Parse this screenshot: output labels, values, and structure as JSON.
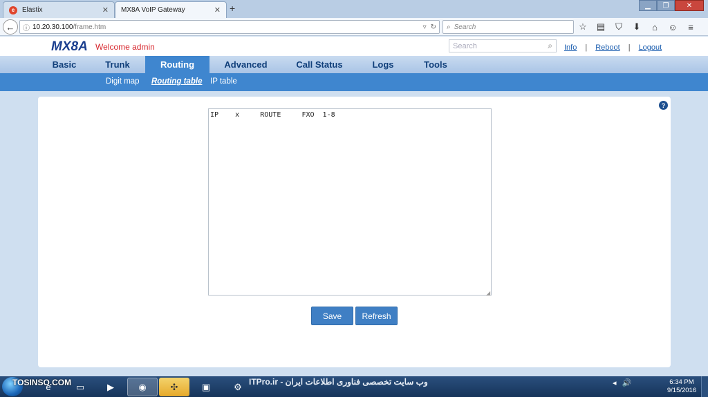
{
  "browser": {
    "tabs": [
      {
        "title": "Elastix",
        "active": false
      },
      {
        "title": "MX8A VoIP Gateway",
        "active": true
      }
    ],
    "new_tab": "+",
    "url_host": "10.20.30.100",
    "url_path": "/frame.htm",
    "search_placeholder": "Search"
  },
  "app": {
    "logo": "MX8A",
    "welcome": "Welcome admin",
    "search_placeholder": "Search",
    "links": {
      "info": "Info",
      "reboot": "Reboot",
      "logout": "Logout"
    },
    "nav": [
      "Basic",
      "Trunk",
      "Routing",
      "Advanced",
      "Call Status",
      "Logs",
      "Tools"
    ],
    "nav_active": "Routing",
    "subnav": [
      "Digit map",
      "Routing table",
      "IP table"
    ],
    "subnav_active": "Routing table",
    "help": "?",
    "routing_table_text": "IP    x     ROUTE     FXO  1-8",
    "buttons": {
      "save": "Save",
      "refresh": "Refresh"
    },
    "colors": {
      "accent": "#3f86cf",
      "logo": "#1b3f8f",
      "welcome": "#d7262d",
      "link": "#1d5fb0"
    }
  },
  "taskbar": {
    "overlay_text": "TOSINSO.COM",
    "watermark": "ITPro.ir - وب سایت تخصصی فناوری اطلاعات ایران",
    "time": "6:34 PM",
    "date": "9/15/2016"
  }
}
